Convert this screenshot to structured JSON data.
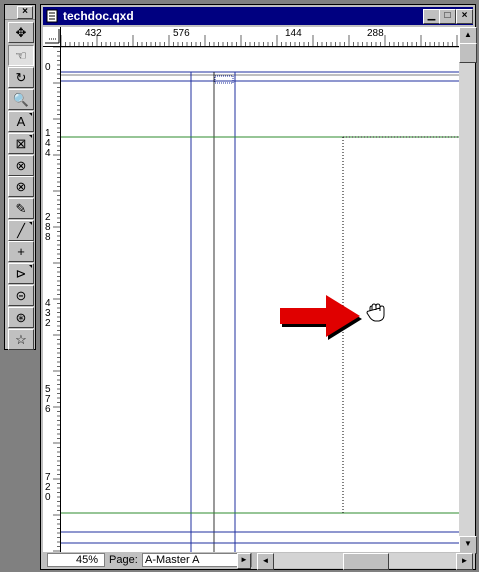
{
  "palette": {
    "close_label": "×",
    "tools": [
      {
        "name": "item-tool-icon",
        "glyph": "✥"
      },
      {
        "name": "content-hand-tool-icon",
        "glyph": "☜"
      },
      {
        "name": "rotation-tool-icon",
        "glyph": "↻"
      },
      {
        "name": "zoom-tool-icon",
        "glyph": "🔍"
      },
      {
        "name": "text-box-tool-icon",
        "glyph": "A"
      },
      {
        "name": "picture-box-tool-icon",
        "glyph": "⊠"
      },
      {
        "name": "oval-picture-box-tool-icon",
        "glyph": "⊗"
      },
      {
        "name": "round-picture-box-tool-icon",
        "glyph": "⊗"
      },
      {
        "name": "bezier-picture-box-tool-icon",
        "glyph": "✎"
      },
      {
        "name": "line-tool-icon",
        "glyph": "╱"
      },
      {
        "name": "orthogonal-line-tool-icon",
        "glyph": "+"
      },
      {
        "name": "text-path-tool-icon",
        "glyph": "⊳"
      },
      {
        "name": "linking-tool-icon",
        "glyph": "⊝"
      },
      {
        "name": "unlinking-tool-icon",
        "glyph": "⊛"
      },
      {
        "name": "starburst-tool-icon",
        "glyph": "☆"
      }
    ]
  },
  "window": {
    "title": "techdoc.qxd",
    "minimize": "▁",
    "maximize": "□",
    "close": "×"
  },
  "hruler": {
    "labels": [
      "432",
      "576",
      "144",
      "288"
    ]
  },
  "vruler": {
    "labels": [
      {
        "chars": [
          "0"
        ]
      },
      {
        "chars": [
          "1",
          "4",
          "4"
        ]
      },
      {
        "chars": [
          "2",
          "8",
          "8"
        ]
      },
      {
        "chars": [
          "4",
          "3",
          "2"
        ]
      },
      {
        "chars": [
          "5",
          "7",
          "6"
        ]
      },
      {
        "chars": [
          "7",
          "2",
          "0"
        ]
      }
    ]
  },
  "status": {
    "zoom": "45%",
    "page_label": "Page:",
    "page_value": "A-Master A"
  },
  "scroll": {
    "up": "▲",
    "down": "▼",
    "left": "◄",
    "right": "►",
    "dropdown": "►"
  },
  "colors": {
    "titlebar": "#000080",
    "guide_blue": "#1f2f9f",
    "guide_green": "#2e8b2e",
    "arrow_red": "#e00000"
  }
}
